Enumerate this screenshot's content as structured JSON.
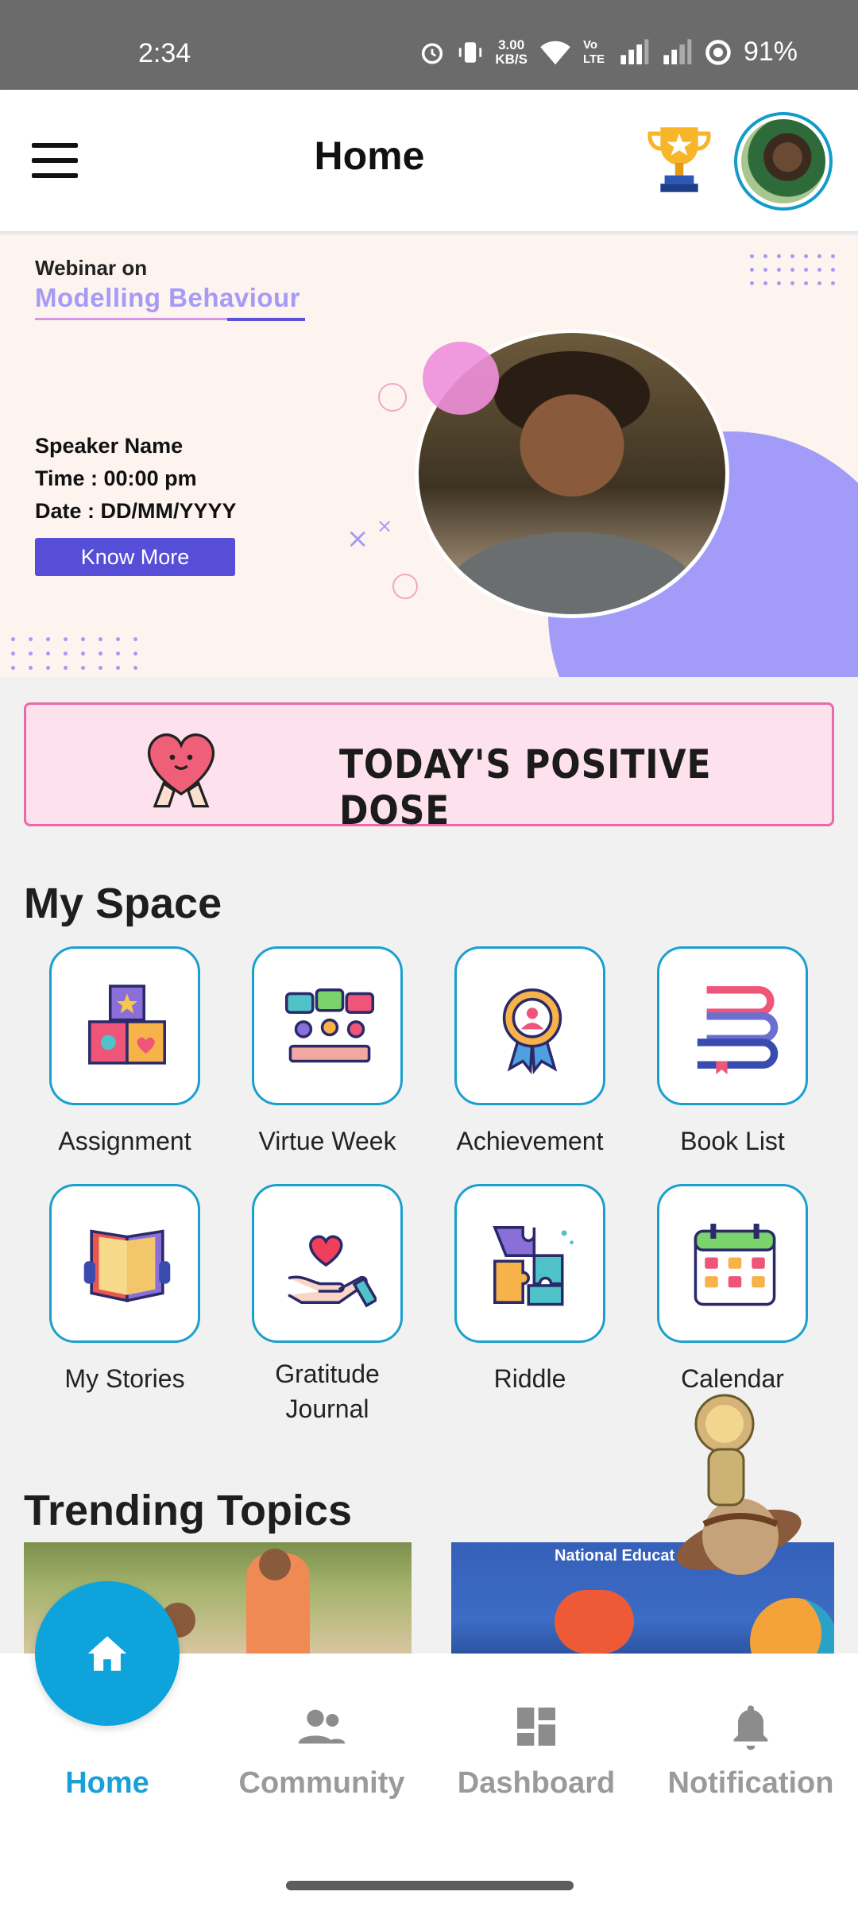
{
  "status_bar": {
    "time": "2:34",
    "net_speed_top": "3.00",
    "net_speed_bottom": "KB/S",
    "volte": "Vo LTE",
    "battery": "91%"
  },
  "header": {
    "title": "Home",
    "trophy_icon": "trophy-icon",
    "avatar_icon": "user-avatar"
  },
  "banner": {
    "kicker": "Webinar on",
    "topic": "Modelling Behaviour",
    "speaker": "Speaker Name",
    "time": "Time : 00:00 pm",
    "date": "Date : DD/MM/YYYY",
    "cta": "Know More",
    "accent": "#564ed6"
  },
  "positive_dose": {
    "label": "TODAY'S POSITIVE DOSE"
  },
  "my_space": {
    "title": "My Space",
    "items": [
      {
        "label": "Assignment",
        "icon": "blocks-icon"
      },
      {
        "label": "Virtue Week",
        "icon": "discussion-icon"
      },
      {
        "label": "Achievement",
        "icon": "badge-icon"
      },
      {
        "label": "Book List",
        "icon": "books-icon"
      },
      {
        "label": "My Stories",
        "icon": "open-book-icon"
      },
      {
        "label": "Gratitude",
        "label2": "Journal",
        "icon": "heart-hand-icon"
      },
      {
        "label": "Riddle",
        "icon": "puzzle-icon"
      },
      {
        "label": "Calendar",
        "icon": "calendar-icon"
      }
    ]
  },
  "trending": {
    "title": "Trending Topics",
    "cards": [
      {
        "caption": ""
      },
      {
        "caption": "National Educat"
      }
    ]
  },
  "bottom_nav": {
    "items": [
      {
        "label": "Home",
        "icon": "home-icon",
        "active": true
      },
      {
        "label": "Community",
        "icon": "people-icon"
      },
      {
        "label": "Dashboard",
        "icon": "dashboard-icon"
      },
      {
        "label": "Notification",
        "icon": "bell-icon"
      }
    ],
    "active_color": "#1aa0d8"
  }
}
